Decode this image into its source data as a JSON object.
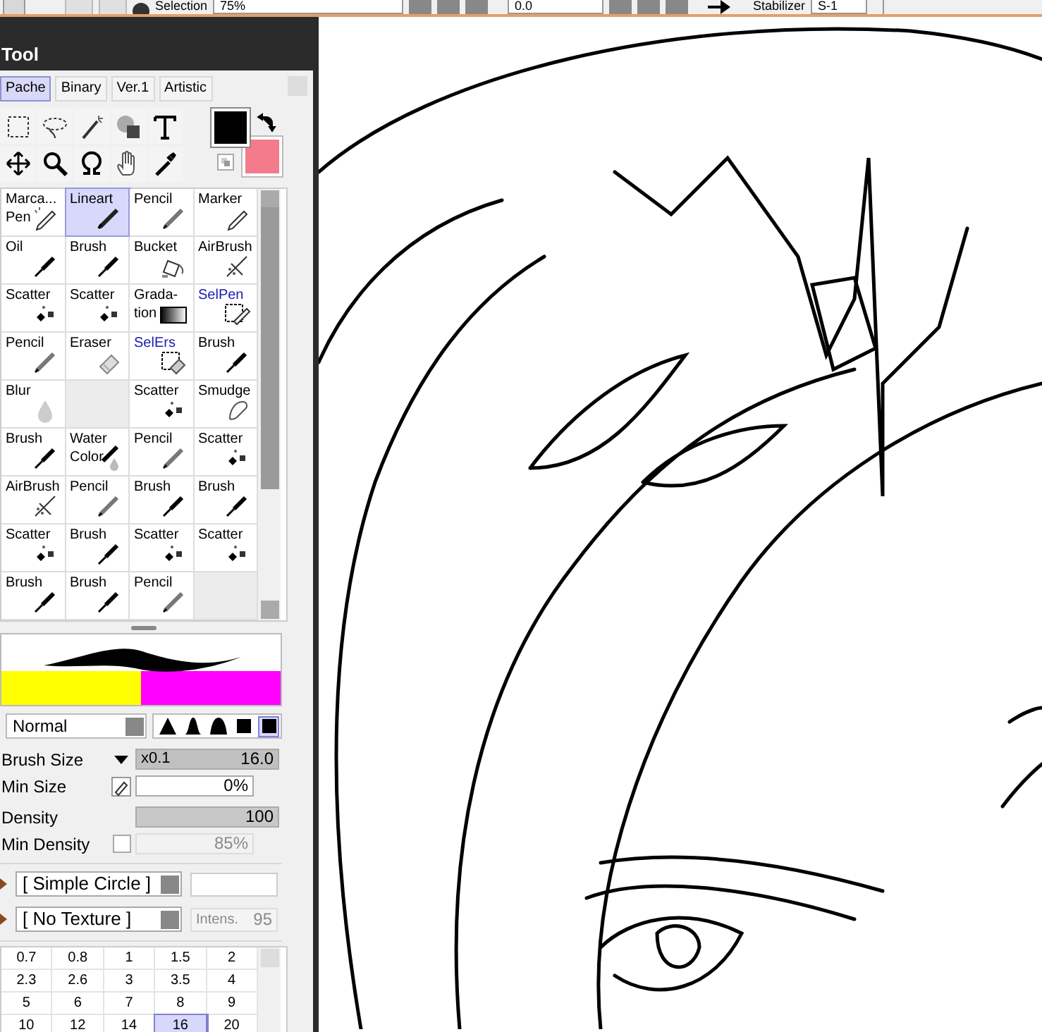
{
  "toolbar": {
    "selection_label": "Selection",
    "zoom": "75%",
    "angle": "0.0",
    "stabilizer_label": "Stabilizer",
    "stabilizer": "S-1"
  },
  "panel": {
    "title": "Tool"
  },
  "tabs": [
    {
      "label": "Pache",
      "selected": true
    },
    {
      "label": "Binary",
      "selected": false
    },
    {
      "label": "Ver.1",
      "selected": false
    },
    {
      "label": "Artistic",
      "selected": false
    }
  ],
  "tools": [
    {
      "label": "Marca...\nPen",
      "kind": "markerpen",
      "selected": false
    },
    {
      "label": "Lineart",
      "kind": "pen",
      "selected": true
    },
    {
      "label": "Pencil",
      "kind": "pencil",
      "selected": false
    },
    {
      "label": "Marker",
      "kind": "marker",
      "selected": false
    },
    {
      "label": "Oil",
      "kind": "brush",
      "selected": false
    },
    {
      "label": "Brush",
      "kind": "brush",
      "selected": false
    },
    {
      "label": "Bucket",
      "kind": "bucket",
      "selected": false
    },
    {
      "label": "AirBrush",
      "kind": "airbrush",
      "selected": false
    },
    {
      "label": "Scatter",
      "kind": "scatter",
      "selected": false
    },
    {
      "label": "Scatter",
      "kind": "scatter",
      "selected": false
    },
    {
      "label": "Grada-\ntion",
      "kind": "gradation",
      "selected": false
    },
    {
      "label": "SelPen",
      "kind": "selpen",
      "selected": false
    },
    {
      "label": "Pencil",
      "kind": "pencil",
      "selected": false
    },
    {
      "label": "Eraser",
      "kind": "eraser",
      "selected": false
    },
    {
      "label": "SelErs",
      "kind": "selers",
      "selected": false
    },
    {
      "label": "Brush",
      "kind": "brush",
      "selected": false
    },
    {
      "label": "Blur",
      "kind": "blur",
      "selected": false
    },
    {
      "kind": "empty"
    },
    {
      "label": "Scatter",
      "kind": "scatter",
      "selected": false
    },
    {
      "label": "Smudge",
      "kind": "smudge",
      "selected": false
    },
    {
      "label": "Brush",
      "kind": "brush",
      "selected": false
    },
    {
      "label": "Water\nColor",
      "kind": "watercolor",
      "selected": false
    },
    {
      "label": "Pencil",
      "kind": "pencil",
      "selected": false
    },
    {
      "label": "Scatter",
      "kind": "scatter",
      "selected": false
    },
    {
      "label": "AirBrush",
      "kind": "airbrush",
      "selected": false
    },
    {
      "label": "Pencil",
      "kind": "pencil",
      "selected": false
    },
    {
      "label": "Brush",
      "kind": "brush",
      "selected": false
    },
    {
      "label": "Brush",
      "kind": "brush",
      "selected": false
    },
    {
      "label": "Scatter",
      "kind": "scatter",
      "selected": false
    },
    {
      "label": "Brush",
      "kind": "brush",
      "selected": false
    },
    {
      "label": "Scatter",
      "kind": "scatter",
      "selected": false
    },
    {
      "label": "Scatter",
      "kind": "scatter",
      "selected": false
    },
    {
      "label": "Brush",
      "kind": "brush",
      "selected": false
    },
    {
      "label": "Brush",
      "kind": "brush",
      "selected": false
    },
    {
      "label": "Pencil",
      "kind": "pencil",
      "selected": false
    },
    {
      "kind": "empty"
    }
  ],
  "blend_mode": "Normal",
  "brush_shapes": [
    {
      "selected": false
    },
    {
      "selected": false
    },
    {
      "selected": false
    },
    {
      "selected": false
    },
    {
      "selected": true
    }
  ],
  "brush_size": {
    "label": "Brush Size",
    "multiplier": "x0.1",
    "value": "16.0",
    "level": 1
  },
  "min_size": {
    "label": "Min Size",
    "value": "0%",
    "level": 0
  },
  "density": {
    "label": "Density",
    "value": "100",
    "level": 1
  },
  "min_density": {
    "label": "Min Density",
    "checked": false,
    "value": "85%",
    "disabled": true
  },
  "brush_shape": "[ Simple Circle ]",
  "texture": "[ No Texture ]",
  "texture_intensity": {
    "label": "Intens.",
    "value": "95",
    "disabled": true
  },
  "sizes": [
    {
      "label": "0.7",
      "selected": false
    },
    {
      "label": "0.8",
      "selected": false
    },
    {
      "label": "1",
      "selected": false
    },
    {
      "label": "1.5",
      "selected": false
    },
    {
      "label": "2",
      "selected": false
    },
    {
      "label": "2.3",
      "selected": false
    },
    {
      "label": "2.6",
      "selected": false
    },
    {
      "label": "3",
      "selected": false
    },
    {
      "label": "3.5",
      "selected": false
    },
    {
      "label": "4",
      "selected": false
    },
    {
      "label": "5",
      "selected": false
    },
    {
      "label": "6",
      "selected": false
    },
    {
      "label": "7",
      "selected": false
    },
    {
      "label": "8",
      "selected": false
    },
    {
      "label": "9",
      "selected": false
    },
    {
      "label": "10",
      "selected": false
    },
    {
      "label": "12",
      "selected": false
    },
    {
      "label": "14",
      "selected": false
    },
    {
      "label": "16",
      "selected": true
    },
    {
      "label": "20",
      "selected": false
    }
  ]
}
